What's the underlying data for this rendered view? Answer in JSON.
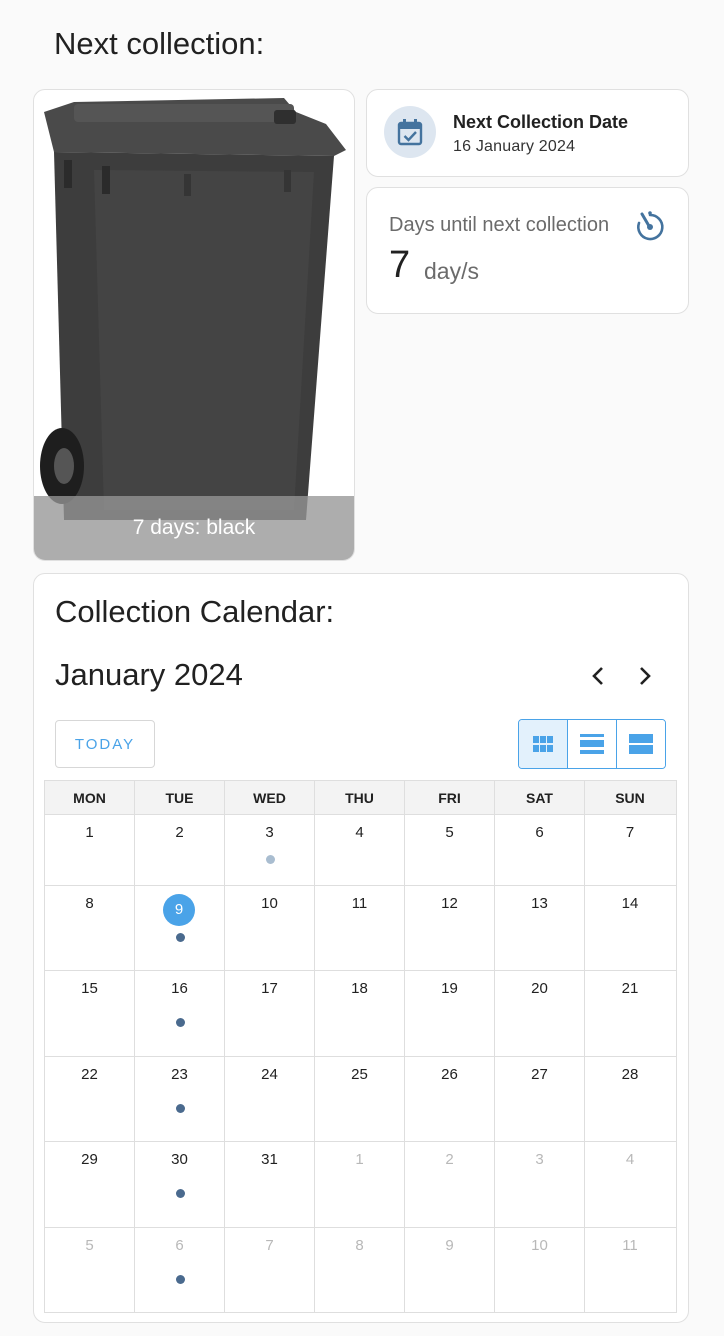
{
  "header": {
    "title": "Next collection:"
  },
  "bin": {
    "caption": "7 days: black",
    "color": "#3a3a3a"
  },
  "next_date": {
    "icon": "calendar-check-icon",
    "title": "Next Collection Date",
    "value": "16 January 2024"
  },
  "days_until": {
    "label": "Days until next collection",
    "icon": "timer-icon",
    "value": "7",
    "unit": "day/s"
  },
  "calendar": {
    "title": "Collection Calendar:",
    "month": "January 2024",
    "today_label": "TODAY",
    "prev_icon": "chevron-left-icon",
    "next_icon": "chevron-right-icon",
    "views": [
      "month-view-icon",
      "week-view-icon",
      "day-view-icon"
    ],
    "active_view": "month",
    "weekdays": [
      "MON",
      "TUE",
      "WED",
      "THU",
      "FRI",
      "SAT",
      "SUN"
    ],
    "accent": "#4aa3e8",
    "weeks": [
      [
        {
          "d": "1"
        },
        {
          "d": "2"
        },
        {
          "d": "3",
          "dot": "past"
        },
        {
          "d": "4"
        },
        {
          "d": "5"
        },
        {
          "d": "6"
        },
        {
          "d": "7"
        }
      ],
      [
        {
          "d": "8"
        },
        {
          "d": "9",
          "today": true,
          "dot": "event"
        },
        {
          "d": "10"
        },
        {
          "d": "11"
        },
        {
          "d": "12"
        },
        {
          "d": "13"
        },
        {
          "d": "14"
        }
      ],
      [
        {
          "d": "15"
        },
        {
          "d": "16",
          "dot": "event"
        },
        {
          "d": "17"
        },
        {
          "d": "18"
        },
        {
          "d": "19"
        },
        {
          "d": "20"
        },
        {
          "d": "21"
        }
      ],
      [
        {
          "d": "22"
        },
        {
          "d": "23",
          "dot": "event"
        },
        {
          "d": "24"
        },
        {
          "d": "25"
        },
        {
          "d": "26"
        },
        {
          "d": "27"
        },
        {
          "d": "28"
        }
      ],
      [
        {
          "d": "29"
        },
        {
          "d": "30",
          "dot": "event"
        },
        {
          "d": "31"
        },
        {
          "d": "1",
          "other": true
        },
        {
          "d": "2",
          "other": true
        },
        {
          "d": "3",
          "other": true
        },
        {
          "d": "4",
          "other": true
        }
      ],
      [
        {
          "d": "5",
          "other": true
        },
        {
          "d": "6",
          "other": true,
          "dot": "event"
        },
        {
          "d": "7",
          "other": true
        },
        {
          "d": "8",
          "other": true
        },
        {
          "d": "9",
          "other": true
        },
        {
          "d": "10",
          "other": true
        },
        {
          "d": "11",
          "other": true
        }
      ]
    ]
  }
}
